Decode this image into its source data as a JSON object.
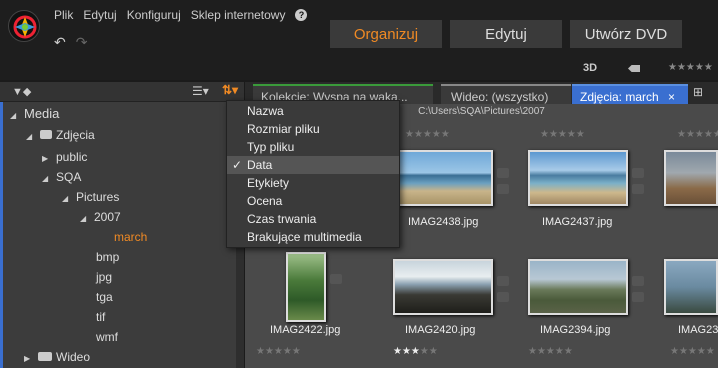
{
  "menu": {
    "items": [
      "Plik",
      "Edytuj",
      "Konfiguruj",
      "Sklep internetowy"
    ],
    "help": "?"
  },
  "modes": {
    "organize": "Organizuj",
    "edit": "Edytuj",
    "dvd": "Utwórz DVD"
  },
  "toolbar": {
    "three_d": "3D",
    "stars": "★★★★★"
  },
  "tree": {
    "media": "Media",
    "photos": "Zdjęcia",
    "public": "public",
    "sqa": "SQA",
    "pictures": "Pictures",
    "year": "2007",
    "march": "march",
    "bmp": "bmp",
    "jpg": "jpg",
    "tga": "tga",
    "tif": "tif",
    "wmf": "wmf",
    "video": "Wideo"
  },
  "tabs": {
    "collections": "Kolekcje: Wyspa na waka...",
    "video": "Wideo: (wszystko)",
    "photos": "Zdjęcia: march",
    "close": "×"
  },
  "path": "C:\\Users\\SQA\\Pictures\\2007",
  "sort_menu": {
    "items": [
      "Nazwa",
      "Rozmiar pliku",
      "Typ pliku",
      "Data",
      "Etykiety",
      "Ocena",
      "Czas trwania",
      "Brakujące multimedia"
    ],
    "selected": "Data",
    "check": "✓"
  },
  "thumbnails": {
    "t1": {
      "name": "IMAG2438.jpg",
      "stars": "★★★★★"
    },
    "t2": {
      "name": "IMAG2437.jpg",
      "stars": "★★★★★"
    },
    "t3": {
      "name": "IMAG2422.jpg",
      "stars": "★★★★★"
    },
    "t4": {
      "name": "IMAG2420.jpg",
      "stars": "★★★★★",
      "rating": 3
    },
    "t5": {
      "name": "IMAG2394.jpg",
      "stars": "★★★★★"
    },
    "t6": {
      "name": "IMAG23",
      "stars": "★★★★★"
    }
  },
  "colors": {
    "accent": "#f08a24",
    "selected_tab": "#3a6fd0"
  }
}
